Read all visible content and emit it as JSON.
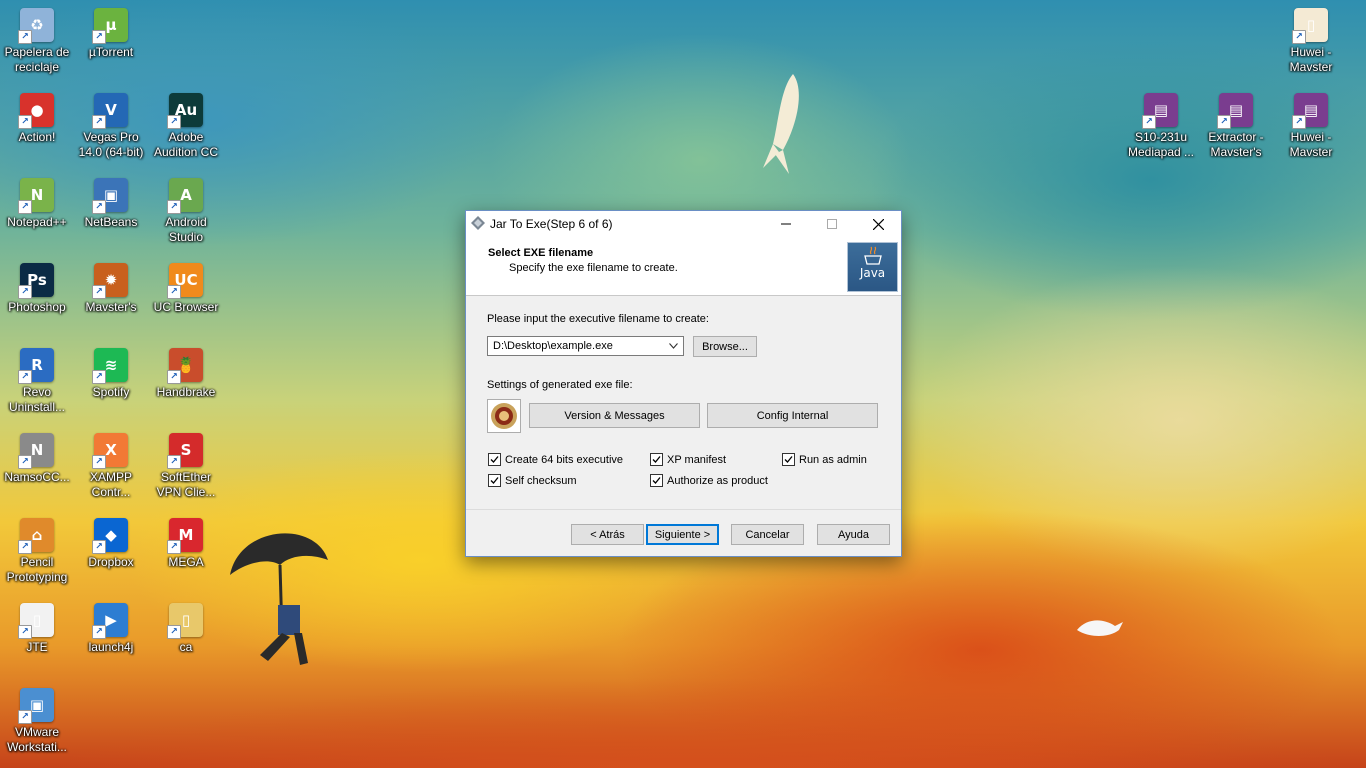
{
  "desktop": {
    "icons": [
      {
        "label": "Papelera de\nreciclaje",
        "color": "#8fb3d9",
        "glyph": "♻"
      },
      {
        "label": "µTorrent",
        "color": "#6bb33f",
        "glyph": "µ"
      },
      {
        "label": "Action!",
        "color": "#d8322c",
        "glyph": "●"
      },
      {
        "label": "Vegas Pro\n14.0 (64-bit)",
        "color": "#2468b5",
        "glyph": "V"
      },
      {
        "label": "Adobe\nAudition CC",
        "color": "#0d3b3a",
        "glyph": "Au"
      },
      {
        "label": "Notepad++",
        "color": "#7ab34a",
        "glyph": "N"
      },
      {
        "label": "NetBeans",
        "color": "#3b74b8",
        "glyph": "▣"
      },
      {
        "label": "Android\nStudio",
        "color": "#6aa84f",
        "glyph": "A"
      },
      {
        "label": "Photoshop",
        "color": "#0b2b45",
        "glyph": "Ps"
      },
      {
        "label": "Mavster's",
        "color": "#c8601e",
        "glyph": "✹"
      },
      {
        "label": "UC Browser",
        "color": "#f08a1c",
        "glyph": "UC"
      },
      {
        "label": "Revo\nUninstall...",
        "color": "#2b6cc2",
        "glyph": "R"
      },
      {
        "label": "Spotify",
        "color": "#1db954",
        "glyph": "≋"
      },
      {
        "label": "Handbrake",
        "color": "#c94d2c",
        "glyph": "🍍"
      },
      {
        "label": "NamsoCC...",
        "color": "#8a8a8a",
        "glyph": "N"
      },
      {
        "label": "XAMPP\nContr...",
        "color": "#f27935",
        "glyph": "X"
      },
      {
        "label": "SoftEther\nVPN Clie...",
        "color": "#d42b2b",
        "glyph": "S"
      },
      {
        "label": "Pencil\nPrototyping",
        "color": "#e08a2b",
        "glyph": "⌂"
      },
      {
        "label": "Dropbox",
        "color": "#0a66d2",
        "glyph": "◆"
      },
      {
        "label": "MEGA",
        "color": "#d9272e",
        "glyph": "M"
      },
      {
        "label": "JTE",
        "color": "#f2f2f2",
        "glyph": "▯"
      },
      {
        "label": "launch4j",
        "color": "#2d7dd2",
        "glyph": "▶"
      },
      {
        "label": "ca",
        "color": "#e8c86a",
        "glyph": "▯"
      },
      {
        "label": "VMware\nWorkstati...",
        "color": "#4b8fd1",
        "glyph": "▣"
      },
      {
        "label": "Huwei -\nMavster",
        "color": "#f4ead4",
        "glyph": "▯"
      },
      {
        "label": "S10-231u\nMediapad ...",
        "color": "#7a3d8f",
        "glyph": "▤"
      },
      {
        "label": "Extractor -\nMavster's",
        "color": "#7a3d8f",
        "glyph": "▤"
      },
      {
        "label": "Huwei -\nMavster",
        "color": "#7a3d8f",
        "glyph": "▤"
      }
    ]
  },
  "dialog": {
    "title": "Jar To Exe(Step 6 of 6)",
    "header_title": "Select EXE filename",
    "header_subtitle": "Specify the exe filename to create.",
    "logo_text": "Java",
    "input_label": "Please input the executive filename to create:",
    "filename_value": "D:\\Desktop\\example.exe",
    "browse_label": "Browse...",
    "settings_label": "Settings of generated exe file:",
    "version_button": "Version & Messages",
    "config_button": "Config Internal",
    "options": {
      "create64": {
        "label": "Create 64 bits executive",
        "checked": true
      },
      "xp_manifest": {
        "label": "XP manifest",
        "checked": true
      },
      "run_as_admin": {
        "label": "Run as admin",
        "checked": true
      },
      "self_checksum": {
        "label": "Self checksum",
        "checked": true
      },
      "authorize": {
        "label": "Authorize as product",
        "checked": true
      }
    },
    "buttons": {
      "back": "< Atrás",
      "next": "Siguiente >",
      "cancel": "Cancelar",
      "help": "Ayuda"
    }
  },
  "colors": {
    "accent": "#0078d7",
    "dialog_bg": "#f0f0f0"
  }
}
